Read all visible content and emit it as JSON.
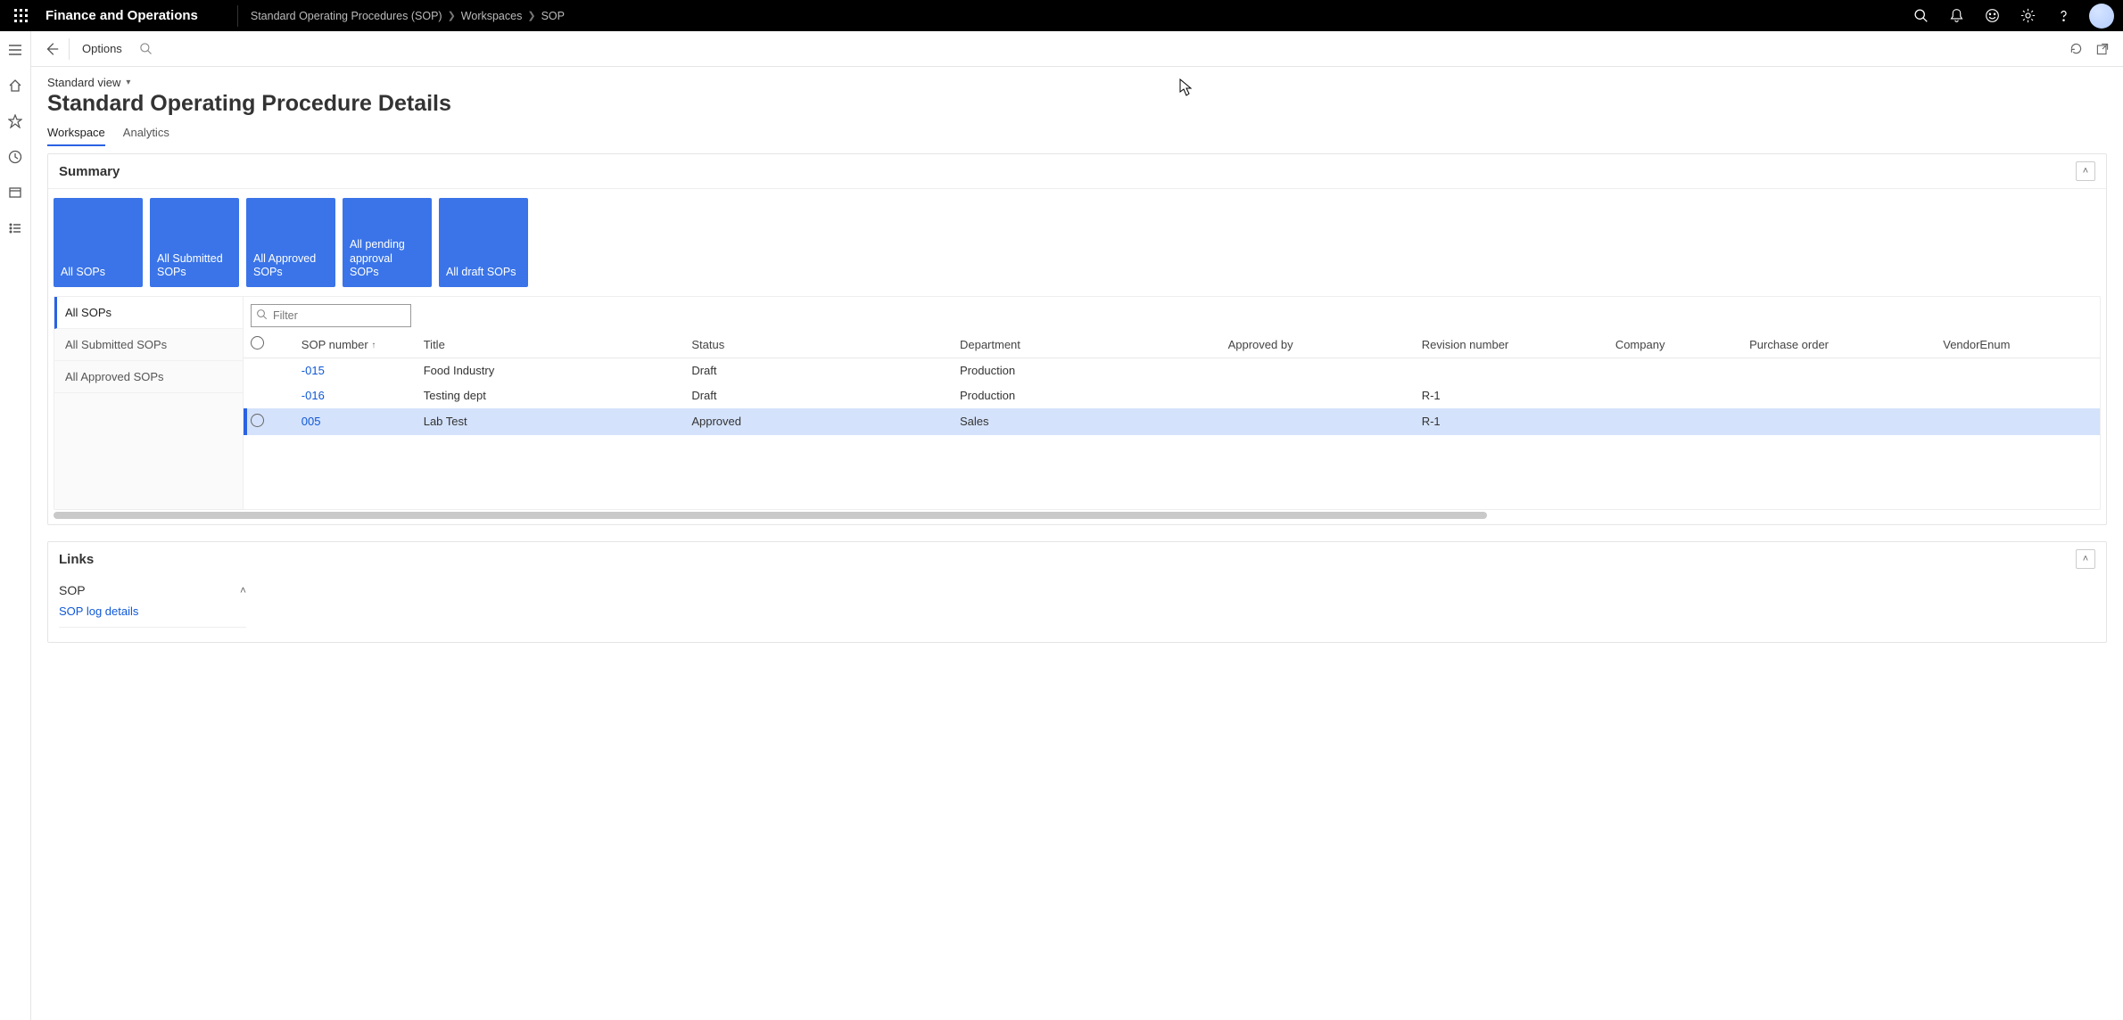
{
  "brand": "Finance and Operations",
  "breadcrumb": [
    "Standard Operating Procedures (SOP)",
    "Workspaces",
    "SOP"
  ],
  "actionbar": {
    "options": "Options"
  },
  "view_label": "Standard view",
  "page_title": "Standard Operating Procedure Details",
  "tabs": [
    "Workspace",
    "Analytics"
  ],
  "summary": {
    "heading": "Summary",
    "tiles": [
      "All SOPs",
      "All Submitted SOPs",
      "All Approved SOPs",
      "All pending approval SOPs",
      "All draft SOPs"
    ],
    "list_panel": [
      "All SOPs",
      "All Submitted SOPs",
      "All Approved SOPs"
    ],
    "filter_placeholder": "Filter",
    "columns": [
      "SOP number",
      "Title",
      "Status",
      "Department",
      "Approved by",
      "Revision number",
      "Company",
      "Purchase order",
      "VendorEnum"
    ],
    "rows": [
      {
        "num": "-015",
        "title": "Food Industry",
        "status": "Draft",
        "dept": "Production",
        "appr": "",
        "rev": "",
        "comp": "",
        "po": "",
        "vend": ""
      },
      {
        "num": "-016",
        "title": "Testing dept",
        "status": "Draft",
        "dept": "Production",
        "appr": "",
        "rev": "R-1",
        "comp": "",
        "po": "",
        "vend": ""
      },
      {
        "num": "005",
        "title": "Lab Test",
        "status": "Approved",
        "dept": "Sales",
        "appr": "",
        "rev": "R-1",
        "comp": "",
        "po": "",
        "vend": ""
      }
    ],
    "selected_row_index": 2
  },
  "links": {
    "heading": "Links",
    "group": "SOP",
    "items": [
      "SOP log details"
    ]
  }
}
